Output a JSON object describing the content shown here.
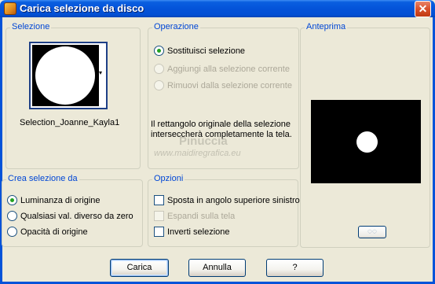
{
  "window": {
    "title": "Carica selezione da disco",
    "close_glyph": "✕"
  },
  "selezione": {
    "legend": "Selezione",
    "name": "Selection_Joanne_Kayla1",
    "dropdown_glyph": "▾"
  },
  "operazione": {
    "legend": "Operazione",
    "options": [
      {
        "label": "Sostituisci selezione",
        "checked": true,
        "enabled": true
      },
      {
        "label": "Aggiungi alla selezione corrente",
        "checked": false,
        "enabled": false
      },
      {
        "label": "Rimuovi dalla selezione corrente",
        "checked": false,
        "enabled": false
      }
    ],
    "info": "Il rettangolo originale della selezione interseccherà completamente la tela."
  },
  "watermark": {
    "line1": "Pinuccia",
    "line2": "www.maidiregrafica.eu"
  },
  "anteprima": {
    "legend": "Anteprima",
    "button_glyph": "◌◌"
  },
  "crea": {
    "legend": "Crea selezione da",
    "options": [
      {
        "label": "Luminanza di origine",
        "checked": true
      },
      {
        "label": "Qualsiasi val. diverso da zero",
        "checked": false
      },
      {
        "label": "Opacità di origine",
        "checked": false
      }
    ]
  },
  "opzioni": {
    "legend": "Opzioni",
    "items": [
      {
        "label": "Sposta in angolo superiore sinistro",
        "checked": false,
        "enabled": true
      },
      {
        "label": "Espandi sulla tela",
        "checked": false,
        "enabled": false
      },
      {
        "label": "Inverti selezione",
        "checked": false,
        "enabled": true
      }
    ]
  },
  "buttons": {
    "ok": "Carica",
    "cancel": "Annulla",
    "help": "?"
  },
  "colors": {
    "title_bar": "#0453D9",
    "legend_text": "#0046D5",
    "radio_dot": "#21A121",
    "face": "#ECE9D8"
  }
}
